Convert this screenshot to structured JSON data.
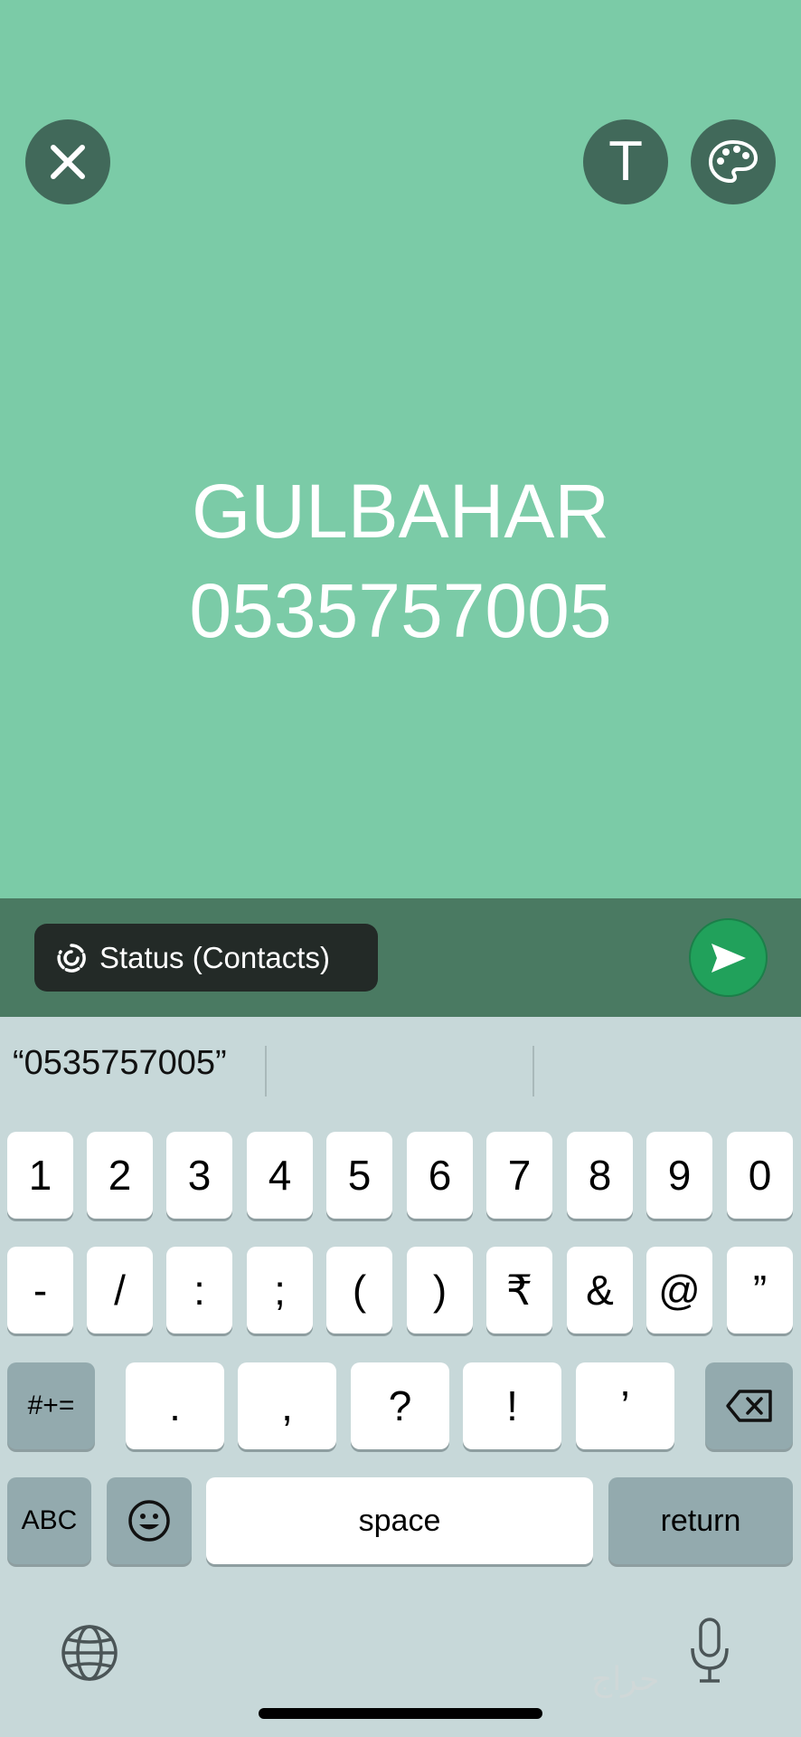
{
  "canvas": {
    "background": "#7bcba7",
    "text_line1": "GULBAHAR",
    "text_line2": "0535757005"
  },
  "toolbar": {
    "close_icon": "close-icon",
    "text_icon": "T",
    "palette_icon": "palette-icon"
  },
  "bottom_bar": {
    "audience_label": "Status (Contacts)",
    "send_icon": "send-icon"
  },
  "keyboard": {
    "suggestions": [
      "“0535757005”",
      "",
      ""
    ],
    "row1": [
      "1",
      "2",
      "3",
      "4",
      "5",
      "6",
      "7",
      "8",
      "9",
      "0"
    ],
    "row2": [
      "-",
      "/",
      ":",
      ";",
      "(",
      ")",
      "₹",
      "&",
      "@",
      "”"
    ],
    "row3": [
      ".",
      ",",
      "?",
      "!",
      "’"
    ],
    "symbols_key": "#+=",
    "abc_key": "ABC",
    "space_key": "space",
    "return_key": "return"
  },
  "watermark": "حراج",
  "colors": {
    "accent_send": "#21a15b",
    "button_bg": "#41695a",
    "bar_bg": "#4a7a62"
  }
}
